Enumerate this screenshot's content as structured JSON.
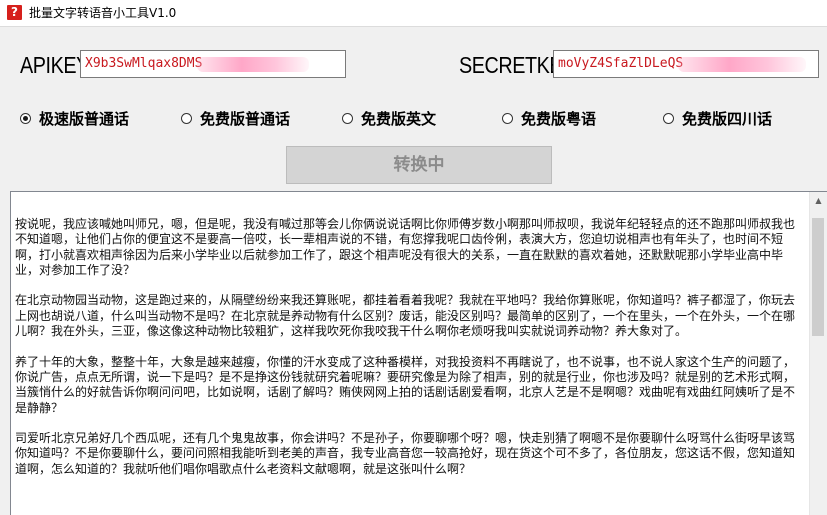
{
  "window": {
    "icon_glyph": "?",
    "title": "批量文字转语音小工具V1.0"
  },
  "credentials": {
    "apikey_label": "APIKEY",
    "apikey_value": "X9b3SwMlqax8DMS",
    "secretkey_label": "SECRETKEY",
    "secretkey_value": "moVyZ4SfaZlDLeQS"
  },
  "voice_options": [
    {
      "label": "极速版普通话",
      "selected": true
    },
    {
      "label": "免费版普通话",
      "selected": false
    },
    {
      "label": "免费版英文",
      "selected": false
    },
    {
      "label": "免费版粤语",
      "selected": false
    },
    {
      "label": "免费版四川话",
      "selected": false
    }
  ],
  "convert_button": {
    "label": "转换中",
    "enabled": false
  },
  "text_body": {
    "paragraphs": [
      "按说呢，我应该喊她叫师兄，嗯，但是呢，我没有喊过那等会儿你俩说说话啊比你师傅岁数小啊那叫师叔呗，我说年纪轻轻点的还不跑那叫师叔我也不知道嗯，让他们占你的便宜这不是要高一倍哎，长一辈相声说的不错，有您撑我呢口齿伶俐，表演大方，您迫切说相声也有年头了，也时间不短啊，打小就喜欢相声徐因为后来小学毕业以后就参加工作了，跟这个相声呢没有很大的关系，一直在默默的喜欢着她，还默默呢那小学毕业高中毕业，对参加工作了没？",
      "在北京动物园当动物，这是跑过来的，从隔壁纷纷来我还算账呢，都挂着看着我呢？我就在平地吗？我给你算账呢，你知道吗？裤子都湿了，你玩去上网也胡说八道，什么叫当动物不是吗？在北京就是养动物有什么区别？废话，能没区别吗？最简单的区别了，一个在里头，一个在外头，一个在哪儿啊？我在外头，三亚，像这像这种动物比较粗犷，这样我吹死你我咬我干什么啊你老烦呀我叫实就说词养动物？养大象对了。",
      "养了十年的大象，整整十年，大象是越来越瘦，你懂的汗水变成了这种番模样，对我投资料不再瞎说了，也不说事，也不说人家这个生产的问题了，你说广告，点点无所谓，说一下是吗？是不是挣这份钱就研究着呢嘛？要研究像是为除了相声，别的就是行业，你也涉及吗？就是别的艺术形式啊，当簇悄什么的好就告诉你啊问问吧，比如说啊，话剧了解吗？贿侠网网上拍的话剧话剧爱看啊，北京人艺是不是啊嗯？戏曲呢有戏曲红阿姨听了是不是静静？",
      "司爱听北京兄弟好几个西瓜呢，还有几个鬼鬼故事，你会讲吗？不是孙子，你要聊哪个呀？嗯，快走别猜了啊嗯不是你要聊什么呀骂什么街呀早该骂你知道吗？不是你要聊什么，要问问照相我能听到老美的声音，我专业高音您一较高抢好，现在货这个可不多了，各位朋友，您这话不假，您知道知道啊，怎么知道的？我就听他们唱你唱歌点什么老资料文献嗯啊，就是这张叫什么啊？"
    ]
  }
}
